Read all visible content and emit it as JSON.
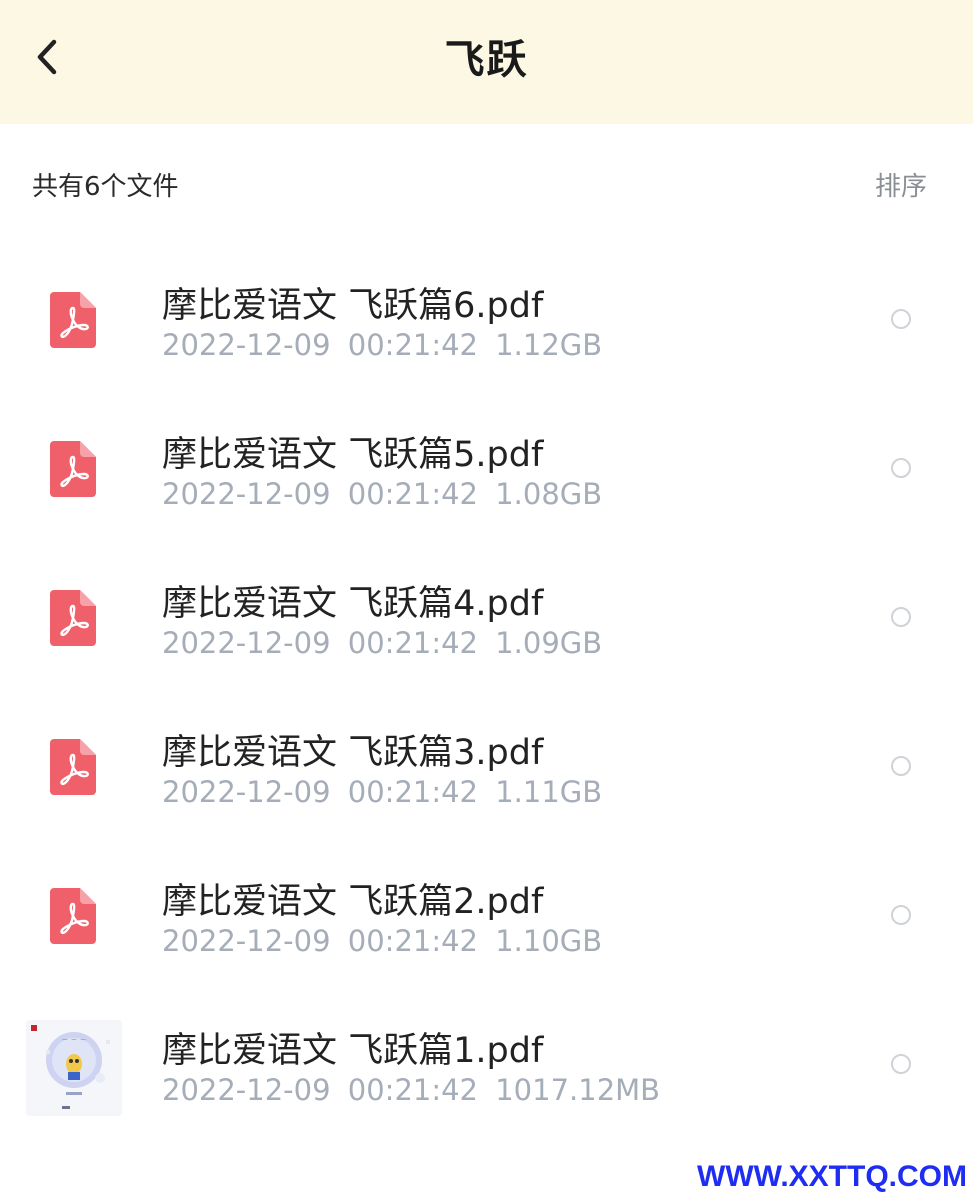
{
  "header": {
    "title": "飞跃",
    "back_icon": "chevron-left-icon"
  },
  "toolbar": {
    "count_label": "共有6个文件",
    "sort_label": "排序"
  },
  "files": [
    {
      "name": "摩比爱语文 飞跃篇6.pdf",
      "date": "2022-12-09",
      "time": "00:21:42",
      "size": "1.12GB",
      "icon": "pdf-icon"
    },
    {
      "name": "摩比爱语文 飞跃篇5.pdf",
      "date": "2022-12-09",
      "time": "00:21:42",
      "size": "1.08GB",
      "icon": "pdf-icon"
    },
    {
      "name": "摩比爱语文 飞跃篇4.pdf",
      "date": "2022-12-09",
      "time": "00:21:42",
      "size": "1.09GB",
      "icon": "pdf-icon"
    },
    {
      "name": "摩比爱语文 飞跃篇3.pdf",
      "date": "2022-12-09",
      "time": "00:21:42",
      "size": "1.11GB",
      "icon": "pdf-icon"
    },
    {
      "name": "摩比爱语文 飞跃篇2.pdf",
      "date": "2022-12-09",
      "time": "00:21:42",
      "size": "1.10GB",
      "icon": "pdf-icon"
    },
    {
      "name": "摩比爱语文 飞跃篇1.pdf",
      "date": "2022-12-09",
      "time": "00:21:42",
      "size": "1017.12MB",
      "icon": "thumbnail-image"
    }
  ],
  "watermark": "WWW.XXTTQ.COM",
  "colors": {
    "header_bg": "#fcf8e4",
    "pdf_red": "#f0606a",
    "meta_gray": "#a5adb8",
    "watermark_blue": "#1f2cf2"
  }
}
